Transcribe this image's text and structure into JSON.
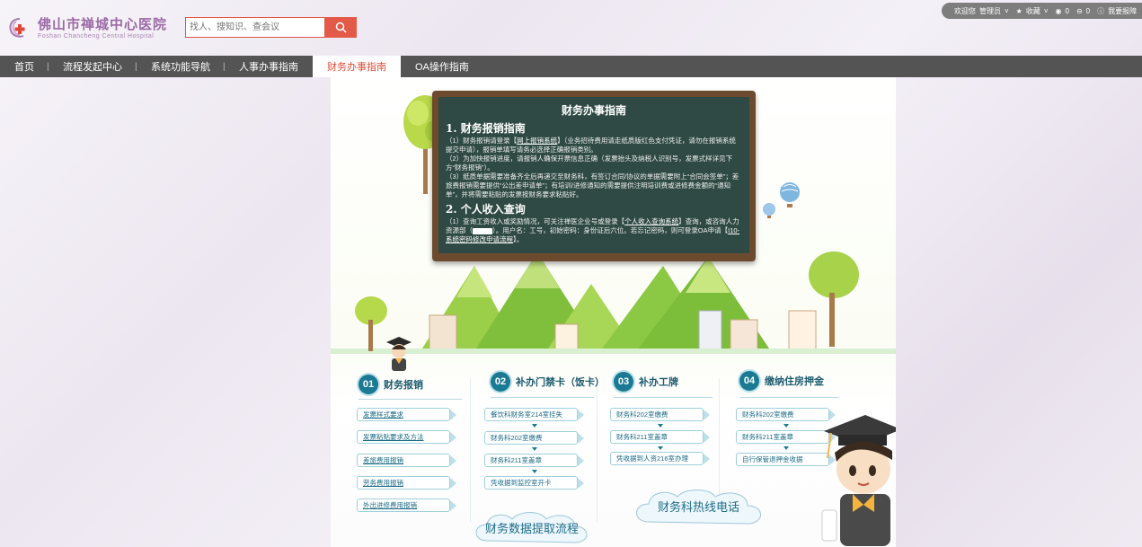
{
  "header": {
    "logo_cn": "佛山市禅城中心医院",
    "logo_en": "Foshan Chancheng Central Hospital",
    "search_placeholder": "找人、搜知识、查会议",
    "topbar": {
      "welcome": "欢迎您",
      "user": "管理员",
      "favorites": "收藏",
      "count_a": "0",
      "count_b": "0",
      "feedback": "我要报障"
    }
  },
  "nav": {
    "items": [
      "首页",
      "流程发起中心",
      "系统功能导航",
      "人事办事指南",
      "财务办事指南",
      "OA操作指南"
    ],
    "active_index": 4
  },
  "board": {
    "title": "财务办事指南",
    "section1_title": "1. 财务报销指南",
    "p1_pre": "（1）财务报销请登录【",
    "p1_link": "网上报销系统",
    "p1_post": "】（业务招待费用请走纸质版红色支付凭证，请勿在报销系统提交申请），报销单填写请务必选择正确报销类别。",
    "p2": "（2）为加快报销进度，请报销人确保开票信息正确（发票抬头及纳税人识别号，发票式样详见下方“财务报销”）。",
    "p3": "（3）纸质单据需要准备齐全后再递交至财务科，有签订合同/协议的单据需要附上“合同会签单”；差旅费报销需要提供“公出差申请单”；有培训/进修通知的需要提供注明培训费或进修费金额的“通知单”，并将需要粘贴的发票按财务要求粘贴好。",
    "section2_title": "2. 个人收入查询",
    "p4_pre": "（1）查询工资收入或奖励情况，可关注禅医企业号或登录【",
    "p4_link": "个人收入查询系统",
    "p4_mid": "】查询，或咨询人力资源部（",
    "p4_ext": "",
    "p4_post": "）。用户名：工号，初始密码：身份证后六位。若忘记密码，则可登录OA申请【",
    "p4_link2": "I10-系统密码修改申请流程",
    "p4_end": "】。"
  },
  "sections": [
    {
      "num": "01",
      "title": "财务报销",
      "items": [
        "发票样式要求",
        "发票粘贴要求及方法",
        "差旅费用报销",
        "劳务费用报销",
        "外出进修费用报销"
      ]
    },
    {
      "num": "02",
      "title": "补办门禁卡（饭卡）",
      "items": [
        "餐饮科财务室214室挂失",
        "财务科202室缴费",
        "财务科211室盖章",
        "凭收据到监控室开卡"
      ]
    },
    {
      "num": "03",
      "title": "补办工牌",
      "items": [
        "财务科202室缴费",
        "财务科211室盖章",
        "凭收据到人资216室办理"
      ]
    },
    {
      "num": "04",
      "title": "缴纳住房押金",
      "items": [
        "财务科202室缴费",
        "财务科211室盖章",
        "自行保管退押金收据"
      ]
    }
  ],
  "clouds": {
    "left": "财务数据提取流程",
    "right": "财务科热线电话"
  },
  "colors": {
    "accent": "#e45a48",
    "nav_bg": "#545454",
    "section": "#1a7a93"
  }
}
